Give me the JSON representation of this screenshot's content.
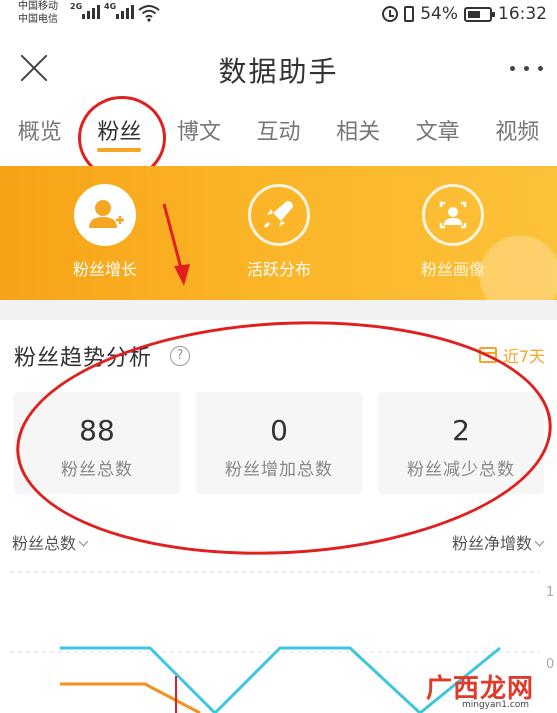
{
  "status_bar": {
    "carrier_1": "中国移动",
    "carrier_2": "中国电信",
    "signal_1_tag": "2G",
    "signal_2_tag": "4G",
    "battery": "54%",
    "time": "16:32"
  },
  "header": {
    "title": "数据助手"
  },
  "tabs": [
    {
      "label": "概览"
    },
    {
      "label": "粉丝",
      "active": true
    },
    {
      "label": "博文"
    },
    {
      "label": "互动"
    },
    {
      "label": "相关"
    },
    {
      "label": "文章"
    },
    {
      "label": "视频"
    }
  ],
  "banner": {
    "items": [
      {
        "label": "粉丝增长",
        "icon": "user-add-icon",
        "selected": true
      },
      {
        "label": "活跃分布",
        "icon": "rocket-icon"
      },
      {
        "label": "粉丝画像",
        "icon": "portrait-icon"
      }
    ]
  },
  "trend": {
    "title": "粉丝趋势分析",
    "help": "?",
    "period": "近7天",
    "stats": [
      {
        "value": "88",
        "label": "粉丝总数"
      },
      {
        "value": "0",
        "label": "粉丝增加总数"
      },
      {
        "value": "2",
        "label": "粉丝减少总数"
      }
    ],
    "left_selector": "粉丝总数",
    "right_selector": "粉丝净增数",
    "right_axis": [
      "1",
      "0"
    ]
  },
  "watermark": {
    "text": "广西龙网",
    "url": "mingyan1.com"
  },
  "colors": {
    "accent": "#f5a623",
    "annotation_red": "#e0201f",
    "line_blue": "#3ec6e0",
    "line_orange": "#f5901e"
  }
}
